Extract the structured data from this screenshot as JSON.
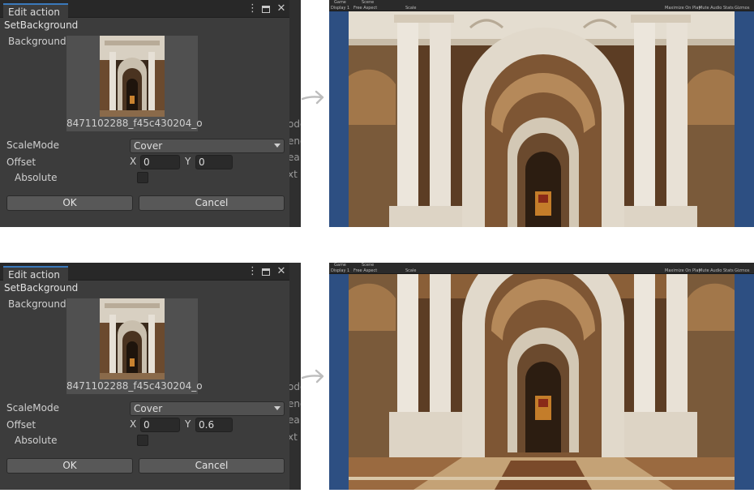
{
  "dialogs": [
    {
      "tab_title": "Edit action",
      "menu_icon": "kebab-menu-icon",
      "close_icon": "close-icon",
      "heading": "SetBackground",
      "background_label": "Background",
      "texture_name": "8471102288_f45c430204_o",
      "scale_mode_label": "ScaleMode",
      "scale_mode_value": "Cover",
      "offset_label": "Offset",
      "x_label": "X",
      "x_value": "0",
      "y_label": "Y",
      "y_value": "0",
      "absolute_label": "Absolute",
      "absolute_checked": false,
      "ok_label": "OK",
      "cancel_label": "Cancel",
      "peek_labels": [
        "ode",
        "end",
        "ea",
        "xt"
      ]
    },
    {
      "tab_title": "Edit action",
      "menu_icon": "kebab-menu-icon",
      "close_icon": "close-icon",
      "heading": "SetBackground",
      "background_label": "Background",
      "texture_name": "8471102288_f45c430204_o",
      "scale_mode_label": "ScaleMode",
      "scale_mode_value": "Cover",
      "offset_label": "Offset",
      "x_label": "X",
      "x_value": "0",
      "y_label": "Y",
      "y_value": "0.6",
      "absolute_label": "Absolute",
      "absolute_checked": false,
      "ok_label": "OK",
      "cancel_label": "Cancel",
      "peek_labels": [
        "ode",
        "end",
        "ea",
        "xt"
      ]
    }
  ],
  "previews": [
    {
      "tabs": [
        "Game",
        "Scene"
      ],
      "toolbar_left": [
        "Display 1",
        "Free Aspect"
      ],
      "toolbar_scale": "Scale",
      "toolbar_right": [
        "Maximize On Play",
        "Mute Audio",
        "Stats",
        "Gizmos"
      ]
    },
    {
      "tabs": [
        "Game",
        "Scene"
      ],
      "toolbar_left": [
        "Display 1",
        "Free Aspect"
      ],
      "toolbar_scale": "Scale",
      "toolbar_right": [
        "Maximize On Play",
        "Mute Audio",
        "Stats",
        "Gizmos"
      ]
    }
  ],
  "colors": {
    "dialog_bg": "#3c3c3c",
    "tab_accent": "#3a79bb",
    "preview_backdrop": "#2d4f82",
    "marble": "#e8e3da",
    "dome": "#7a5a3a"
  }
}
